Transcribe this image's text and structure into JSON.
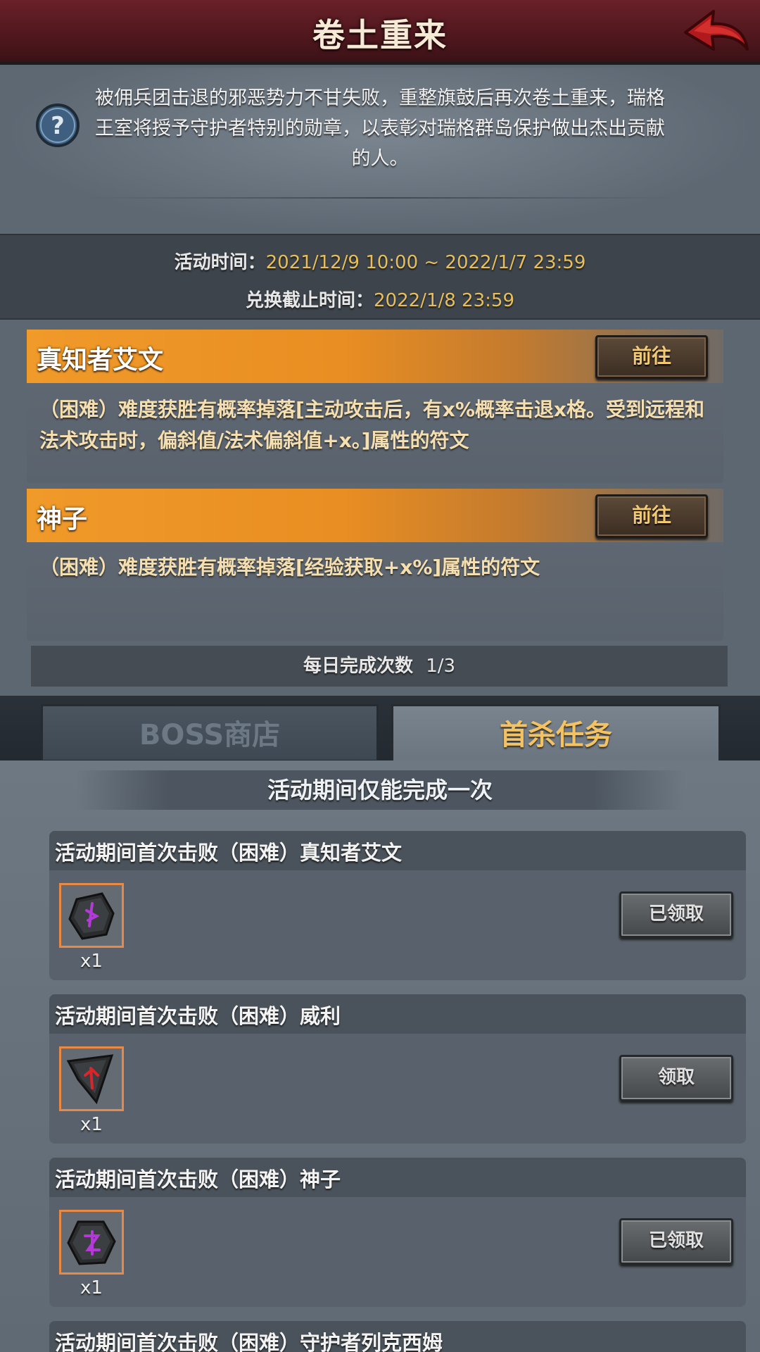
{
  "header": {
    "title": "卷土重来",
    "back_icon": "back-arrow-icon"
  },
  "intro": {
    "text": "被佣兵团击退的邪恶势力不甘失败，重整旗鼓后再次卷土重来，瑞格王室将授予守护者特别的勋章，以表彰对瑞格群岛保护做出杰出贡献的人。"
  },
  "times": {
    "activity_label": "活动时间：",
    "activity_value": "2021/12/9 10:00 ~ 2022/1/7 23:59",
    "exchange_label": "兑换截止时间：",
    "exchange_value": "2022/1/8 23:59"
  },
  "bosses": [
    {
      "name": "真知者艾文",
      "go_label": "前往",
      "desc": "（困难）难度获胜有概率掉落[主动攻击后，有x%概率击退x格。受到远程和法术攻击时，偏斜值/法术偏斜值+x。]属性的符文"
    },
    {
      "name": "神子",
      "go_label": "前往",
      "desc": "（困难）难度获胜有概率掉落[经验获取+x%]属性的符文"
    }
  ],
  "daily": {
    "label": "每日完成次数",
    "value": "1/3"
  },
  "tabs": [
    {
      "label": "BOSS商店",
      "active": false
    },
    {
      "label": "首杀任务",
      "active": true
    }
  ],
  "once_banner": "活动期间仅能完成一次",
  "quests": [
    {
      "title": "活动期间首次击败（困难）真知者艾文",
      "reward_icon": "rune-purple-icon",
      "qty": "x1",
      "button": "已领取"
    },
    {
      "title": "活动期间首次击败（困难）威利",
      "reward_icon": "rune-red-icon",
      "qty": "x1",
      "button": "领取"
    },
    {
      "title": "活动期间首次击败（困难）神子",
      "reward_icon": "rune-purple-icon",
      "qty": "x1",
      "button": "已领取"
    },
    {
      "title": "活动期间首次击败（困难）守护者列克西姆"
    }
  ],
  "colors": {
    "accent_gold": "#e6be5c",
    "tab_active_text": "#f3c262",
    "reward_border": "#e88a46"
  }
}
